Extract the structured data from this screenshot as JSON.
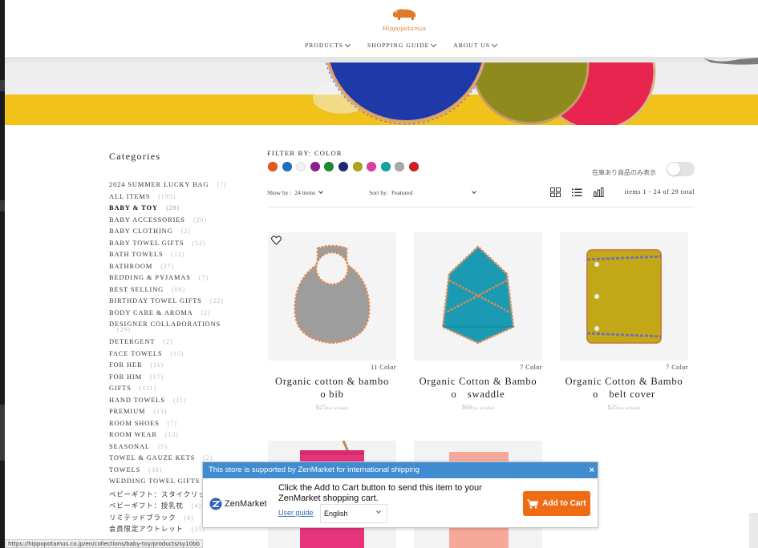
{
  "header": {
    "logo_text": "Hippopotamus",
    "nav": [
      {
        "label": "PRODUCTS"
      },
      {
        "label": "SHOPPING GUIDE"
      },
      {
        "label": "ABOUT US"
      }
    ]
  },
  "categories": {
    "title": "Categories",
    "items": [
      {
        "label": "2024 SUMMER LUCKY BAG",
        "count": "(7)"
      },
      {
        "label": "ALL ITEMS",
        "count": "(195)"
      },
      {
        "label": "BABY & TOY",
        "count": "(29)",
        "active": true
      },
      {
        "label": "BABY ACCESSORIES",
        "count": "(20)"
      },
      {
        "label": "BABY CLOTHING",
        "count": "(2)"
      },
      {
        "label": "BABY TOWEL GIFTS",
        "count": "(52)"
      },
      {
        "label": "BATH TOWELS",
        "count": "(12)"
      },
      {
        "label": "BATHROOM",
        "count": "(27)"
      },
      {
        "label": "BEDDING & PYJAMAS",
        "count": "(7)"
      },
      {
        "label": "BEST SELLING",
        "count": "(66)"
      },
      {
        "label": "BIRTHDAY TOWEL GIFTS",
        "count": "(22)"
      },
      {
        "label": "BODY CARE & AROMA",
        "count": "(2)"
      },
      {
        "label": "DESIGNER COLLABORATIONS",
        "count": "(29)",
        "wrap": true
      },
      {
        "label": "DETERGENT",
        "count": "(2)"
      },
      {
        "label": "FACE TOWELS",
        "count": "(15)"
      },
      {
        "label": "FOR HER",
        "count": "(11)"
      },
      {
        "label": "FOR HIM",
        "count": "(17)"
      },
      {
        "label": "GIFTS",
        "count": "(111)"
      },
      {
        "label": "HAND TOWELS",
        "count": "(11)"
      },
      {
        "label": "PREMIUM",
        "count": "(13)"
      },
      {
        "label": "ROOM SHOES",
        "count": "(7)"
      },
      {
        "label": "ROOM WEAR",
        "count": "(13)"
      },
      {
        "label": "SEASONAL",
        "count": "(5)"
      },
      {
        "label": "TOWEL & GAUZE KETS",
        "count": "(2)"
      },
      {
        "label": "TOWELS",
        "count": "(38)"
      },
      {
        "label": "WEDDING TOWEL GIFTS",
        "count": ""
      },
      {
        "label": "ベビーギフト：スタイクリップ",
        "count": ""
      },
      {
        "label": "ベビーギフト：授乳枕",
        "count": "(4)"
      },
      {
        "label": "リミテッドブラック",
        "count": "(4)"
      },
      {
        "label": "会員限定アウトレット",
        "count": "(25)"
      }
    ]
  },
  "filter": {
    "label": "FILTER BY: COLOR",
    "colors": [
      "#e8581a",
      "#1d6fc4",
      "#f2f2f2",
      "#8f1f8f",
      "#1e8a2e",
      "#1b2a78",
      "#a9a716",
      "#e03c9c",
      "#14a3a1",
      "#a9a9a9",
      "#d01f1f"
    ],
    "stock_label": "在庫あり商品のみ表示"
  },
  "sort": {
    "show_by_label": "Show by :",
    "show_by_value": "24 items",
    "sort_by_label": "Sort by:",
    "sort_by_value": "Featured",
    "items_count": "items 1 - 24 of 29 total"
  },
  "products": [
    {
      "colors": "11 Color",
      "name_line1": "Organic cotton & bambo",
      "name_line2": "o bib",
      "price": "$25",
      "tax": "(tax included)"
    },
    {
      "colors": "7 Color",
      "name_line1": "Organic Cotton & Bambo",
      "name_line2": "o　swaddle",
      "price": "$69",
      "tax": "(tax included)"
    },
    {
      "colors": "7 Color",
      "name_line1": "Organic Cotton & Bambo",
      "name_line2": "o　belt cover",
      "price": "$25",
      "tax": "(tax included)"
    }
  ],
  "status_url": "https://hippopotamus.co.jp/en/collections/baby-toy/products/sy10bb",
  "zenmarket": {
    "header": "This store is supported by ZenMarket for international shipping",
    "close": "×",
    "logo_text": "ZenMarket",
    "message": "Click the Add to Cart button to send this item to your ZenMarket shopping cart.",
    "guide_link": "User guide",
    "language": "English",
    "button": "Add to Cart"
  }
}
